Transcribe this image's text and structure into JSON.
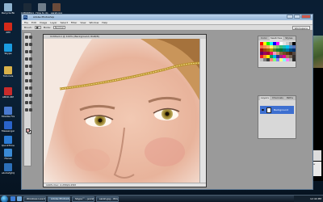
{
  "desktop": {
    "icons": [
      {
        "label": "Recycle Bin",
        "icon": "recycle-bin-icon",
        "color": "#8fb3cf"
      },
      {
        "label": "1484469.jpg",
        "icon": "image-file-icon",
        "color": "#1c2a38"
      },
      {
        "label": "How to do",
        "icon": "document-icon",
        "color": "#6f7d8a"
      },
      {
        "label": "sarah.jpg",
        "icon": "image-file-icon",
        "color": "#6a4a3a"
      },
      {
        "label": "AIM",
        "icon": "aim-icon",
        "color": "#d42a1a"
      },
      {
        "label": "Skype",
        "icon": "skype-icon",
        "color": "#1a9be0"
      },
      {
        "label": "Tutorials",
        "icon": "folder-icon",
        "color": "#d9b24a"
      },
      {
        "label": "ABCD.ZIP",
        "icon": "zip-icon",
        "color": "#c92b2b"
      },
      {
        "label": "Mozilla Firefox",
        "icon": "firefox-icon",
        "color": "#4a7ad0"
      },
      {
        "label": "Messenger",
        "icon": "messenger-icon",
        "color": "#2a63c9"
      },
      {
        "label": "QuickTime Player",
        "icon": "quicktime-icon",
        "color": "#2a7bd5"
      },
      {
        "label": "iTunes",
        "icon": "itunes-icon",
        "color": "#3a8ad5"
      },
      {
        "label": "abcdefghijk",
        "icon": "file-icon",
        "color": "#2c6fb8"
      }
    ]
  },
  "photoshop": {
    "title": "Adobe Photoshop",
    "logo_text": "Ps",
    "menu": [
      "File",
      "Edit",
      "Image",
      "Layer",
      "Select",
      "Filter",
      "View",
      "Window",
      "Help"
    ],
    "options": {
      "brush_label": "Brush:",
      "mode_label": "Mode:",
      "mode_value": "Normal",
      "workspace": "Workspace"
    },
    "document": {
      "title": "Untitled-1 @ 100% (Background, RGB/8)",
      "status": "100%   Doc: 2.25M/2.25M"
    },
    "swatches_panel": {
      "tabs": [
        "Color",
        "Swatches",
        "Styles"
      ],
      "active": "Swatches",
      "colors": [
        "#ff0000",
        "#ffff00",
        "#00ff00",
        "#00ffff",
        "#0000ff",
        "#ff00ff",
        "#ffffff",
        "#e6e6e6",
        "#cccccc",
        "#999999",
        "#000000",
        "#f26c4f",
        "#f68e55",
        "#fbaf5c",
        "#fff467",
        "#acd372",
        "#7cc576",
        "#3bb878",
        "#1abbb4",
        "#00bff3",
        "#438cca",
        "#5574b9",
        "#9e0b0f",
        "#a0410d",
        "#a3620a",
        "#aba000",
        "#598527",
        "#1a7b30",
        "#007236",
        "#00746b",
        "#0076a3",
        "#004b80",
        "#003471",
        "#630460",
        "#9e005d",
        "#9e0039",
        "#ed145b",
        "#f49ac1",
        "#c69c6d",
        "#8c6239",
        "#754c24",
        "#603913",
        "#3c2415",
        "#534741",
        "#ee1d24",
        "#f7941d",
        "#fff200",
        "#00a651",
        "#00aeef",
        "#2e3192",
        "#92278f",
        "#ec008c",
        "#a67c52",
        "#736357",
        "#362f2d",
        "#c0c0c0",
        "#808080",
        "#404040",
        "#ff8080",
        "#80ff80",
        "#8080ff",
        "#ffff80",
        "#80ffff",
        "#ff80ff",
        "#b5b5b5",
        "#2b2b2b"
      ]
    },
    "layers_panel": {
      "tabs": [
        "Layers",
        "Channels",
        "Paths"
      ],
      "active": "Layers",
      "layer_name": "Background"
    }
  },
  "right_gadgets": {
    "note_top": "Photo Gallery",
    "note_bottom": "Click here to add a new gadget"
  },
  "taskbar": {
    "tasks": [
      {
        "label": "Windows Live Messenger",
        "active": false
      },
      {
        "label": "Adobe Photoshop",
        "active": true
      },
      {
        "label": "Skype™ - jennifer",
        "active": false
      },
      {
        "label": "sarah.jpg - Windows",
        "active": false
      }
    ],
    "clock": "12:44 PM"
  }
}
